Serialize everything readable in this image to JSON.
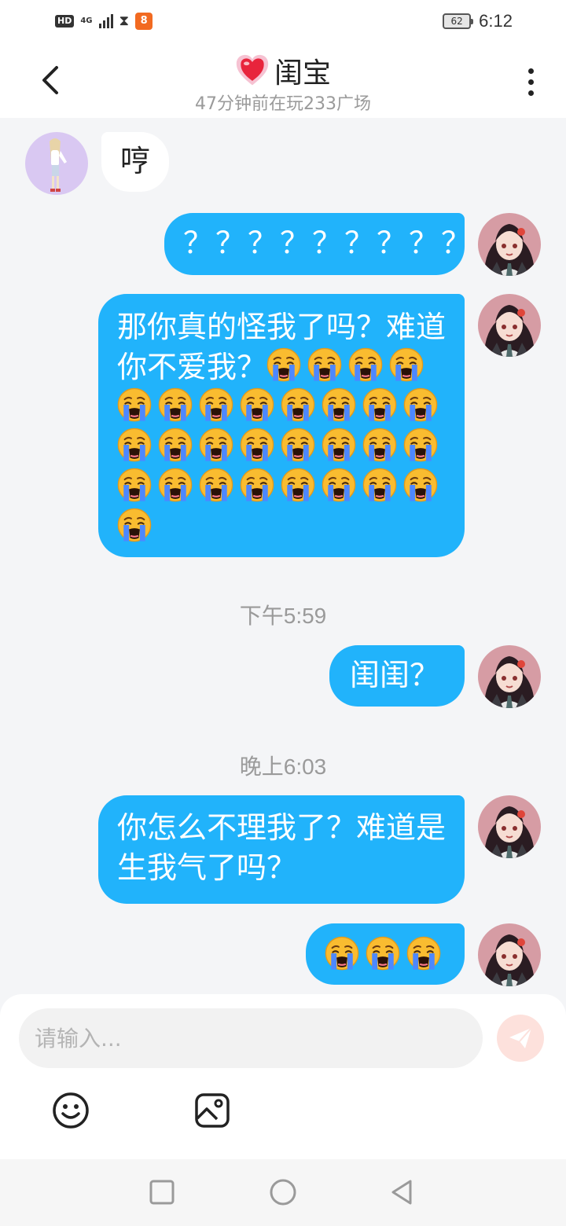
{
  "status_bar": {
    "hd": "HD",
    "network": "4G",
    "app_badge": "8",
    "battery": "62",
    "time": "6:12",
    "icons": [
      "hd-icon",
      "4g-icon",
      "signal-icon",
      "hourglass-icon",
      "app-notification-icon",
      "battery-icon"
    ]
  },
  "header": {
    "title": "闺宝",
    "subtitle": "47分钟前在玩233广场",
    "back_icon": "chevron-left-icon",
    "title_icon": "heart-icon",
    "more_icon": "more-vertical-icon"
  },
  "messages": [
    {
      "from": "them",
      "text": "哼"
    },
    {
      "from": "me",
      "text": "？？？？？？？？？"
    },
    {
      "from": "me",
      "text": "那你真的怪我了吗？难道你不爱我？",
      "emoji": "loudly-crying-face",
      "emoji_count": 29
    },
    {
      "type": "timestamp",
      "text": "下午5:59"
    },
    {
      "from": "me",
      "text": "闺闺？"
    },
    {
      "type": "timestamp",
      "text": "晚上6:03"
    },
    {
      "from": "me",
      "text": "你怎么不理我了？难道是生我气了吗？"
    },
    {
      "from": "me",
      "text": "",
      "emoji": "loudly-crying-face",
      "emoji_count": 3
    }
  ],
  "input": {
    "placeholder": "请输入...",
    "value": "",
    "send_icon": "paper-plane-icon",
    "tools": [
      "emoji-icon",
      "image-icon"
    ]
  },
  "nav_bar": [
    "recent-apps-icon",
    "home-icon",
    "back-icon"
  ],
  "colors": {
    "my_bubble": "#21b3fb",
    "their_bubble": "#ffffff",
    "chat_background": "#f4f5f7",
    "send_button": "#fde1dc"
  }
}
